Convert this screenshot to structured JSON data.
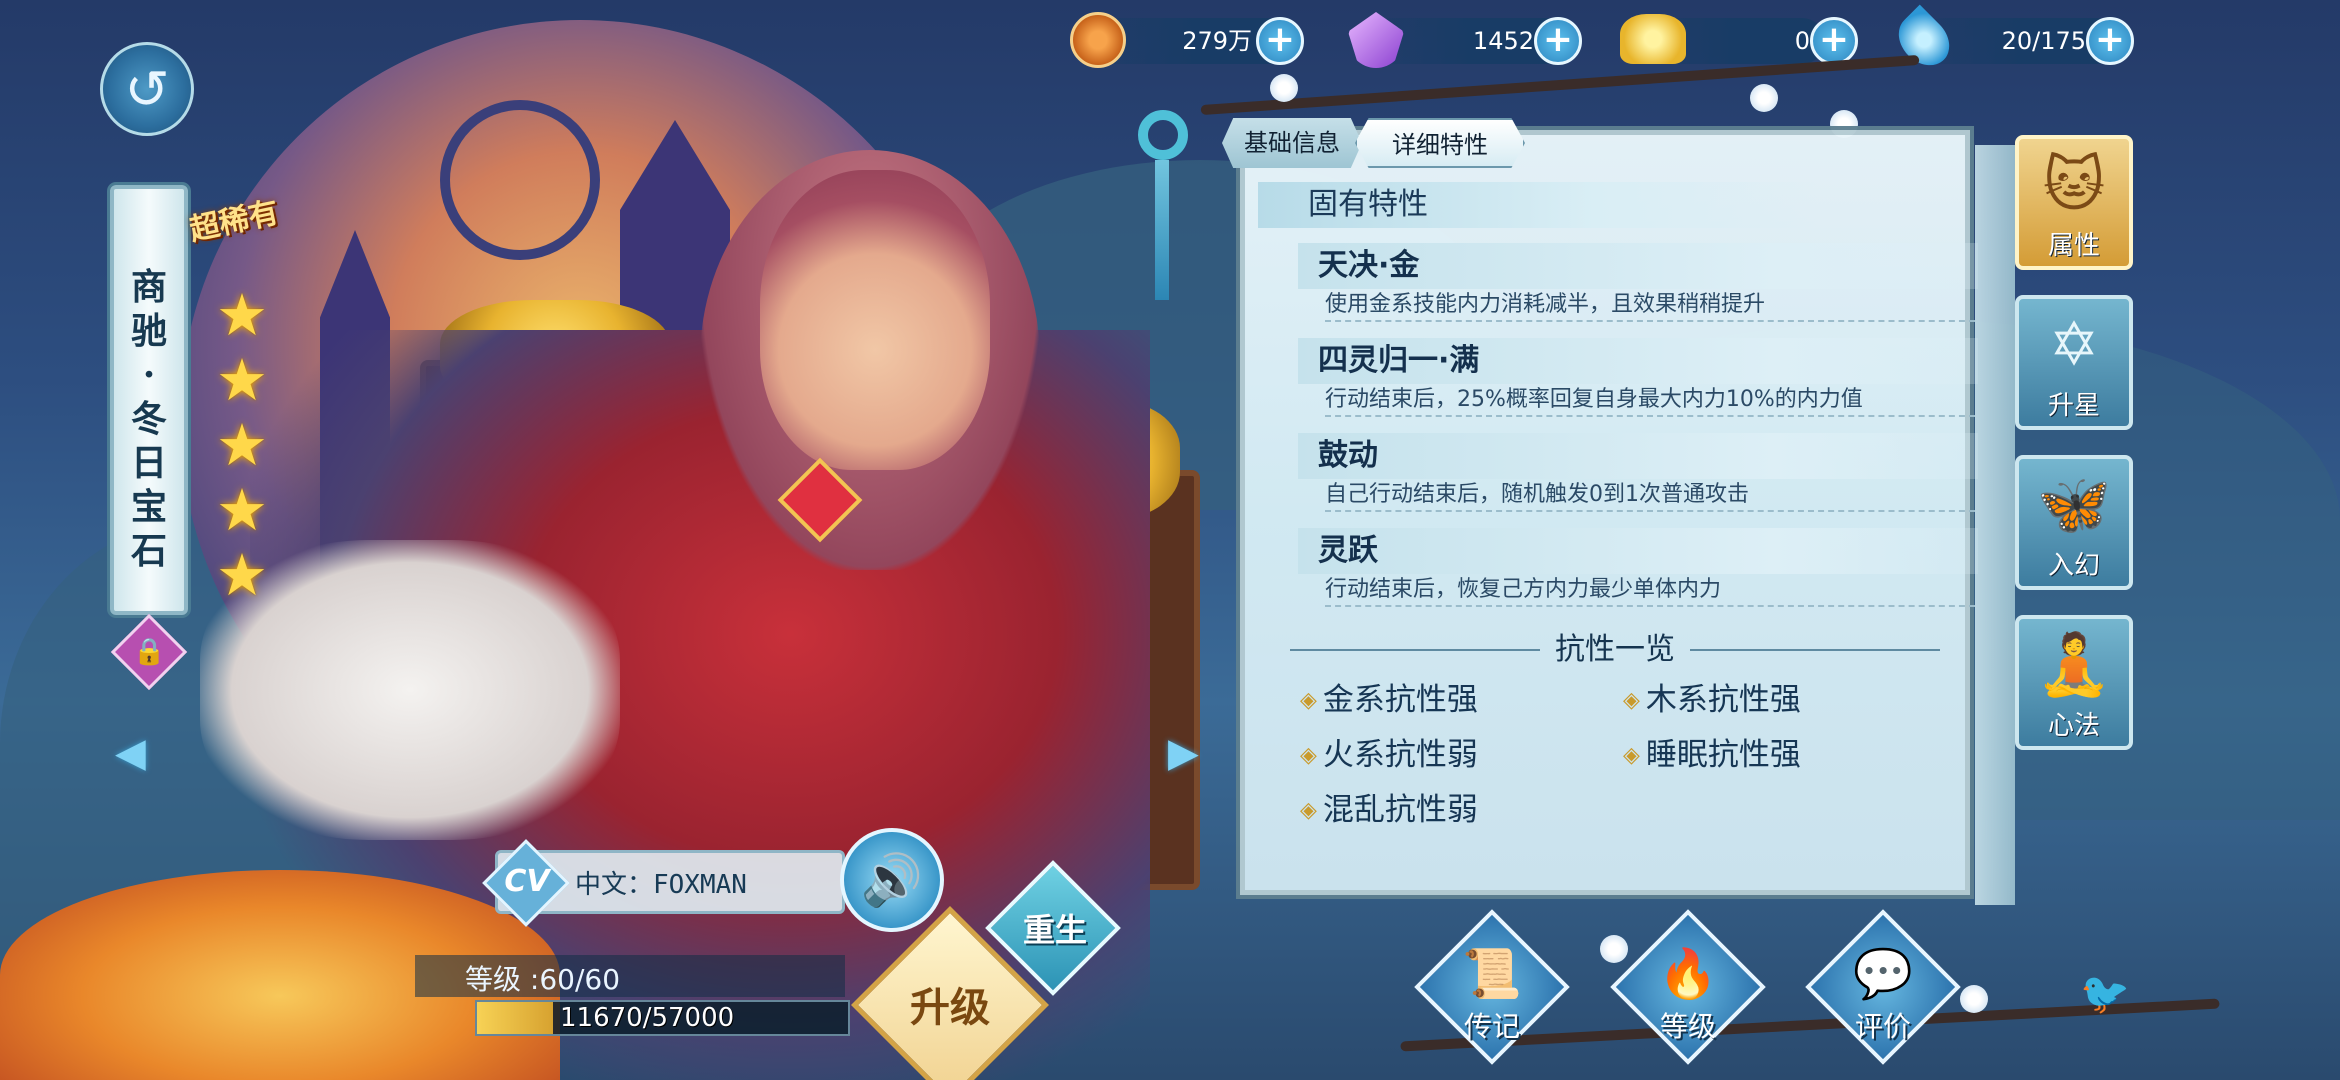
{
  "character": {
    "name_chars": [
      "商",
      "驰",
      "·",
      "冬",
      "日",
      "宝",
      "石"
    ],
    "rarity": "超稀有",
    "stars": 5
  },
  "resources": [
    {
      "icon": "copper-coin-icon",
      "value": "279万"
    },
    {
      "icon": "purple-crystal-icon",
      "value": "1452"
    },
    {
      "icon": "gold-ingot-icon",
      "value": "0"
    },
    {
      "icon": "water-drop-icon",
      "value": "20/175"
    }
  ],
  "tabs": {
    "basic": "基础信息",
    "detail": "详细特性"
  },
  "traits": {
    "section_title": "固有特性",
    "items": [
      {
        "name": "天决·金",
        "desc": "使用金系技能内力消耗减半，且效果稍稍提升"
      },
      {
        "name": "四灵归一·满",
        "desc": "行动结束后，25%概率回复自身最大内力10%的内力值"
      },
      {
        "name": "鼓动",
        "desc": "自己行动结束后，随机触发0到1次普通攻击"
      },
      {
        "name": "灵跃",
        "desc": "行动结束后，恢复己方内力最少单体内力"
      }
    ]
  },
  "resistance": {
    "title": "抗性一览",
    "items": [
      "金系抗性强",
      "木系抗性强",
      "火系抗性弱",
      "睡眠抗性强",
      "混乱抗性弱"
    ]
  },
  "side_buttons": [
    {
      "label": "属性",
      "icon": "cat-mask-icon",
      "active": true
    },
    {
      "label": "升星",
      "icon": "hexagram-icon",
      "active": false
    },
    {
      "label": "入幻",
      "icon": "butterfly-icon",
      "active": false
    },
    {
      "label": "心法",
      "icon": "meditation-icon",
      "active": false
    }
  ],
  "voice": {
    "badge": "CV",
    "text": "中文：FOXMAN"
  },
  "level": {
    "text": "等级 :60/60",
    "exp_text": "11670/57000",
    "exp_fraction": 0.2047
  },
  "actions": {
    "upgrade": "升级",
    "rebirth": "重生"
  },
  "bottom_nav": [
    {
      "label": "传记",
      "icon": "scroll-icon"
    },
    {
      "label": "等级",
      "icon": "flame-icon"
    },
    {
      "label": "评价",
      "icon": "chat-bubbles-icon"
    }
  ],
  "colors": {
    "accent": "#3a97c9",
    "gold": "#ffd84a",
    "panel": "#d7eef6"
  }
}
